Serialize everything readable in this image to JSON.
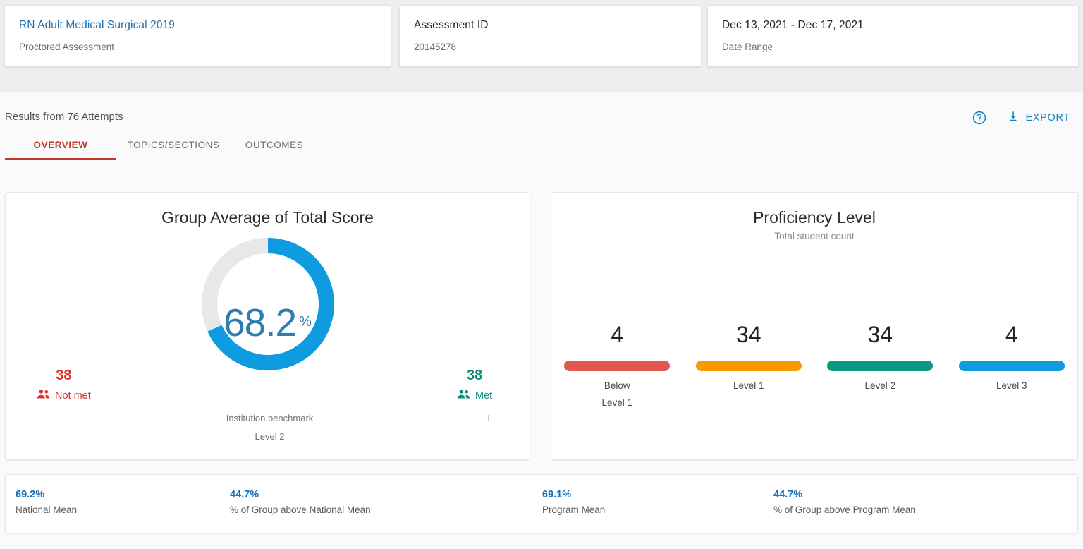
{
  "header": {
    "cards": [
      {
        "title": "RN Adult Medical Surgical 2019",
        "subtitle": "Proctored Assessment",
        "is_link": true
      },
      {
        "title": "Assessment ID",
        "subtitle": "20145278",
        "is_link": false
      },
      {
        "title": "Dec 13, 2021 - Dec 17, 2021",
        "subtitle": "Date Range",
        "is_link": false
      }
    ]
  },
  "results": {
    "count_text": "Results from 76 Attempts",
    "tabs": [
      {
        "label": "OVERVIEW",
        "active": true
      },
      {
        "label": "TOPICS/SECTIONS",
        "active": false
      },
      {
        "label": "OUTCOMES",
        "active": false
      }
    ],
    "help_icon": "help-circle-icon",
    "export_icon": "download-icon",
    "export_label": "EXPORT"
  },
  "chart_data": [
    {
      "type": "pie",
      "title": "Group Average of Total Score",
      "value": 68.2,
      "unit": "%",
      "categories": [
        "Met",
        "Not met"
      ],
      "values": [
        68.2,
        31.8
      ],
      "colors": [
        "#0f9bdf",
        "#e8e8e8"
      ],
      "legend": [
        {
          "count": 38,
          "label": "Not met",
          "color": "#e03127",
          "icon": "people-icon"
        },
        {
          "count": 38,
          "label": "Met",
          "color": "#0e8c7d",
          "icon": "people-icon"
        }
      ],
      "benchmark_label": "Institution benchmark",
      "benchmark_value": "Level 2"
    },
    {
      "type": "bar",
      "title": "Proficiency Level",
      "subtitle": "Total student count",
      "categories": [
        "Below\nLevel 1",
        "Level 1",
        "Level 2",
        "Level 3"
      ],
      "values": [
        4,
        34,
        34,
        4
      ],
      "colors": [
        "#e2564d",
        "#f99b00",
        "#089b81",
        "#0f9bdf"
      ],
      "ylabel": "Total student count"
    }
  ],
  "stats": [
    {
      "value": "69.2%",
      "label": "National Mean"
    },
    {
      "value": "44.7%",
      "label": "% of Group above National Mean"
    },
    {
      "value": "69.1%",
      "label": "Program Mean"
    },
    {
      "value": "44.7%",
      "label": "% of Group above Program Mean"
    }
  ]
}
